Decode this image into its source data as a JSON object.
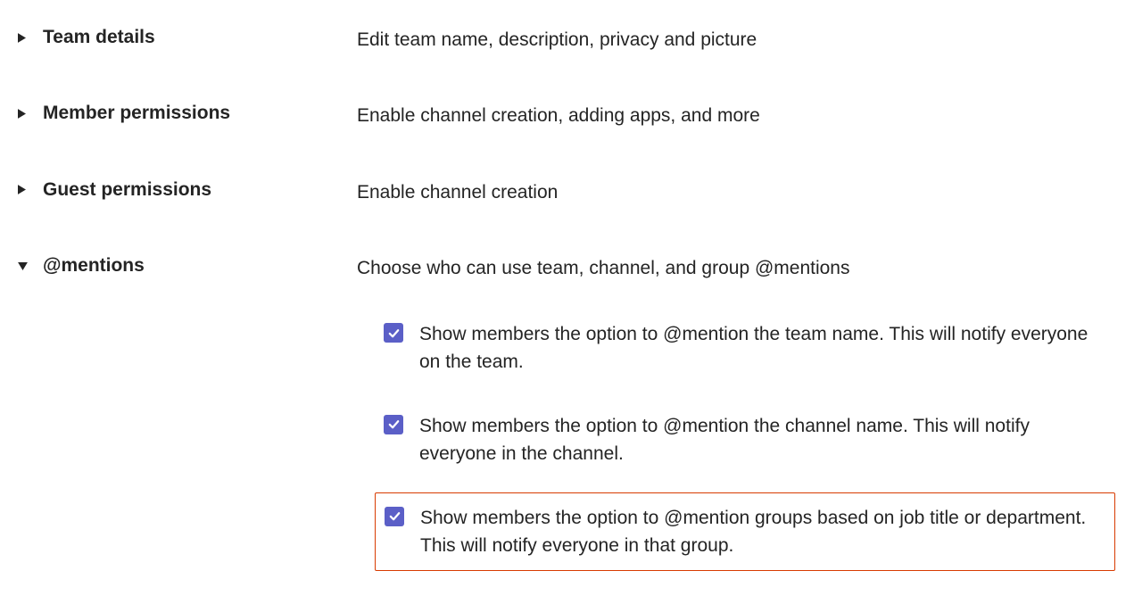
{
  "sections": [
    {
      "title": "Team details",
      "description": "Edit team name, description, privacy and picture",
      "expanded": false
    },
    {
      "title": "Member permissions",
      "description": "Enable channel creation, adding apps, and more",
      "expanded": false
    },
    {
      "title": "Guest permissions",
      "description": "Enable channel creation",
      "expanded": false
    },
    {
      "title": "@mentions",
      "description": "Choose who can use team, channel, and group @mentions",
      "expanded": true,
      "options": [
        {
          "label": "Show members the option to @mention the team name. This will notify everyone on the team.",
          "checked": true,
          "highlighted": false
        },
        {
          "label": "Show members the option to @mention the channel name. This will notify everyone in the channel.",
          "checked": true,
          "highlighted": false
        },
        {
          "label": "Show members the option to @mention groups based on job title or department. This will notify everyone in that group.",
          "checked": true,
          "highlighted": true
        }
      ]
    }
  ]
}
